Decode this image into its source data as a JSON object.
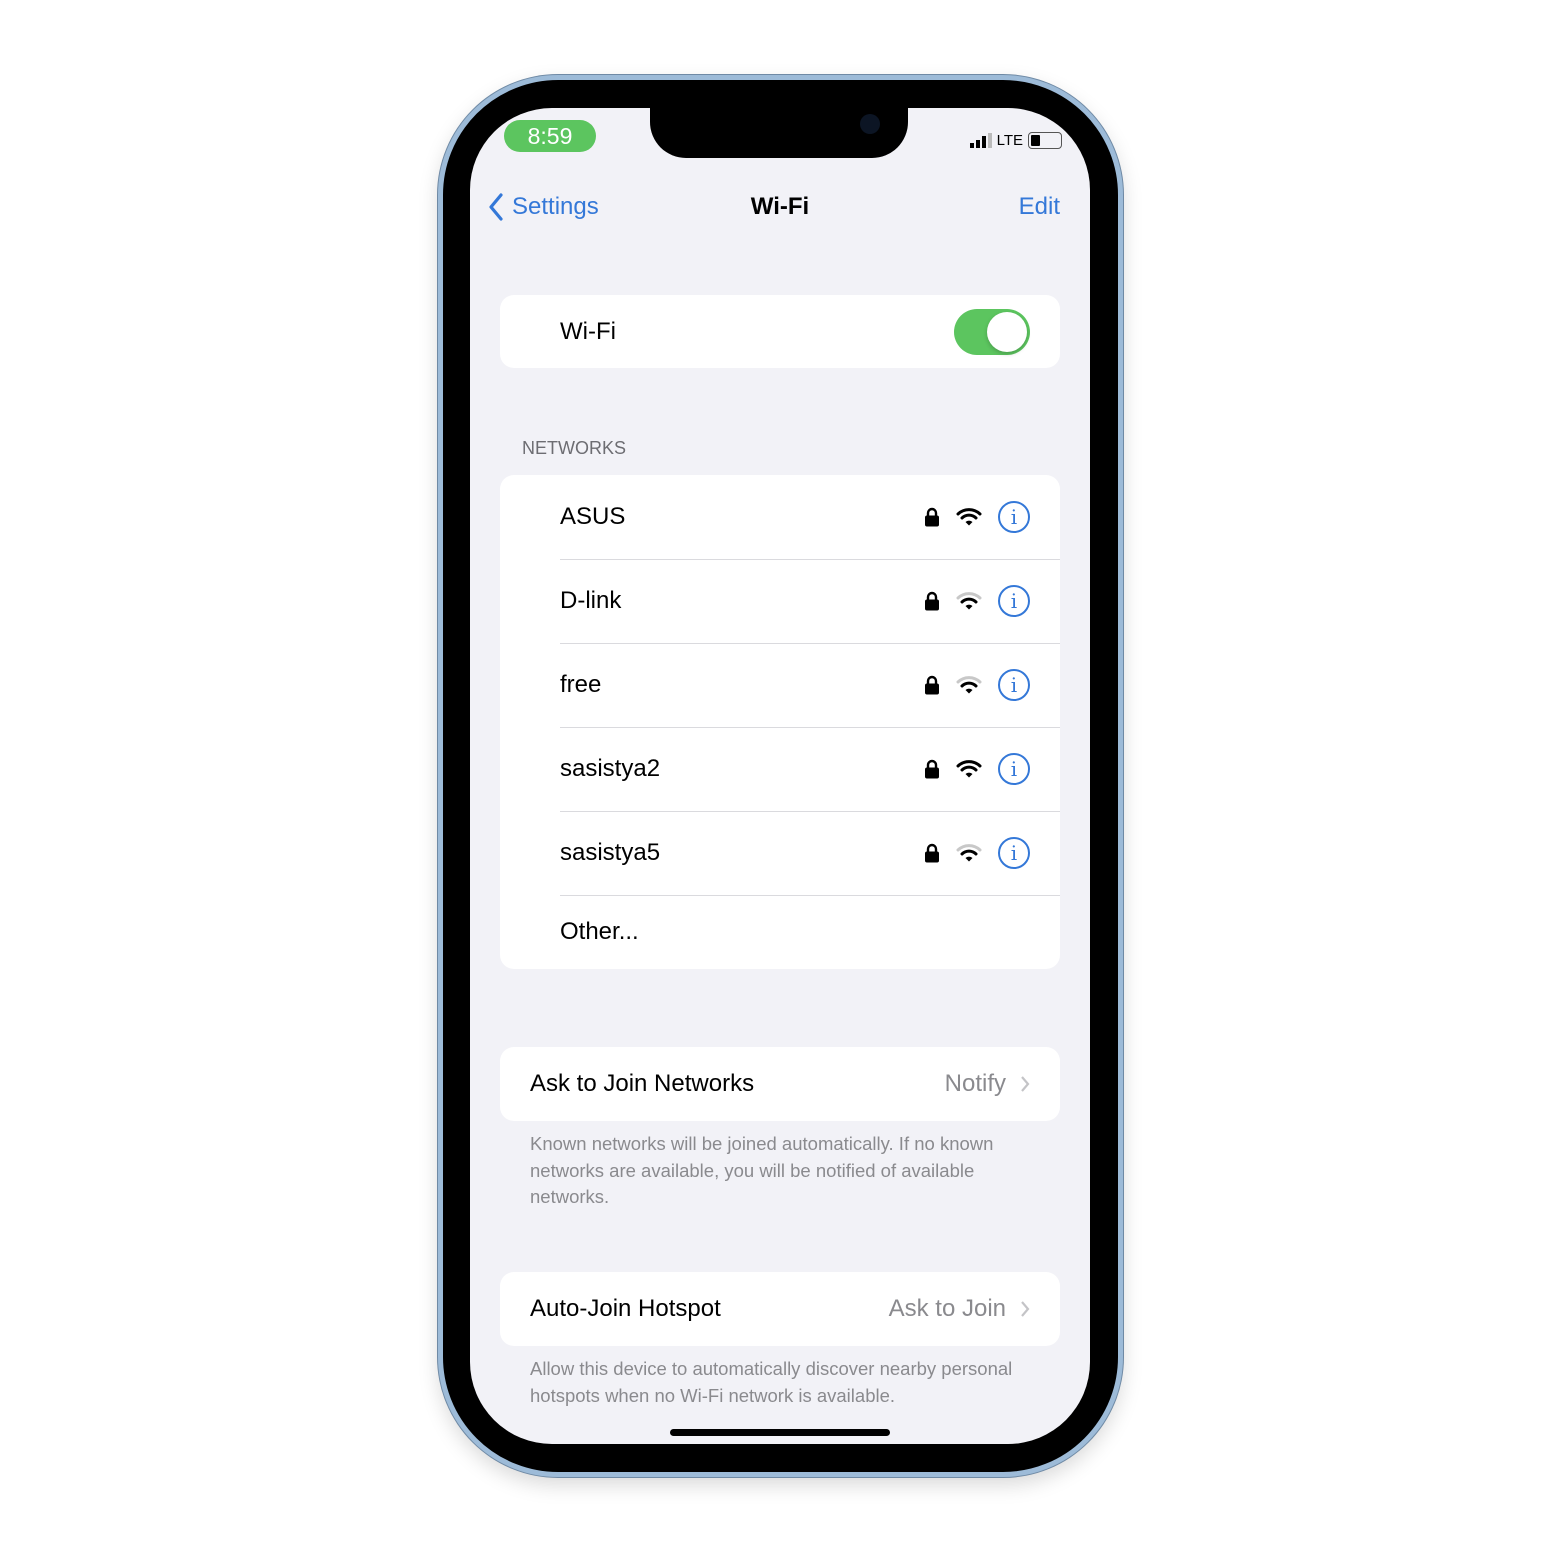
{
  "status": {
    "time": "8:59",
    "carrier": "LTE",
    "battery_level": 0.25,
    "signal_bars": 3
  },
  "nav": {
    "back_label": "Settings",
    "title": "Wi-Fi",
    "edit_label": "Edit"
  },
  "wifi": {
    "label": "Wi-Fi",
    "enabled": true
  },
  "networks": {
    "header": "NETWORKS",
    "items": [
      {
        "name": "ASUS",
        "locked": true,
        "signal": 3
      },
      {
        "name": "D-link",
        "locked": true,
        "signal": 2
      },
      {
        "name": "free",
        "locked": true,
        "signal": 2
      },
      {
        "name": "sasistya2",
        "locked": true,
        "signal": 3
      },
      {
        "name": "sasistya5",
        "locked": true,
        "signal": 2
      }
    ],
    "other_label": "Other..."
  },
  "ask_to_join": {
    "label": "Ask to Join Networks",
    "value": "Notify",
    "footer": "Known networks will be joined automatically. If no known networks are available, you will be notified of available networks."
  },
  "auto_join": {
    "label": "Auto-Join Hotspot",
    "value": "Ask to Join",
    "footer": "Allow this device to automatically discover nearby personal hotspots when no Wi-Fi network is available."
  },
  "colors": {
    "accent": "#3478d8",
    "toggle_on": "#5cc55f",
    "background": "#f2f2f7"
  }
}
